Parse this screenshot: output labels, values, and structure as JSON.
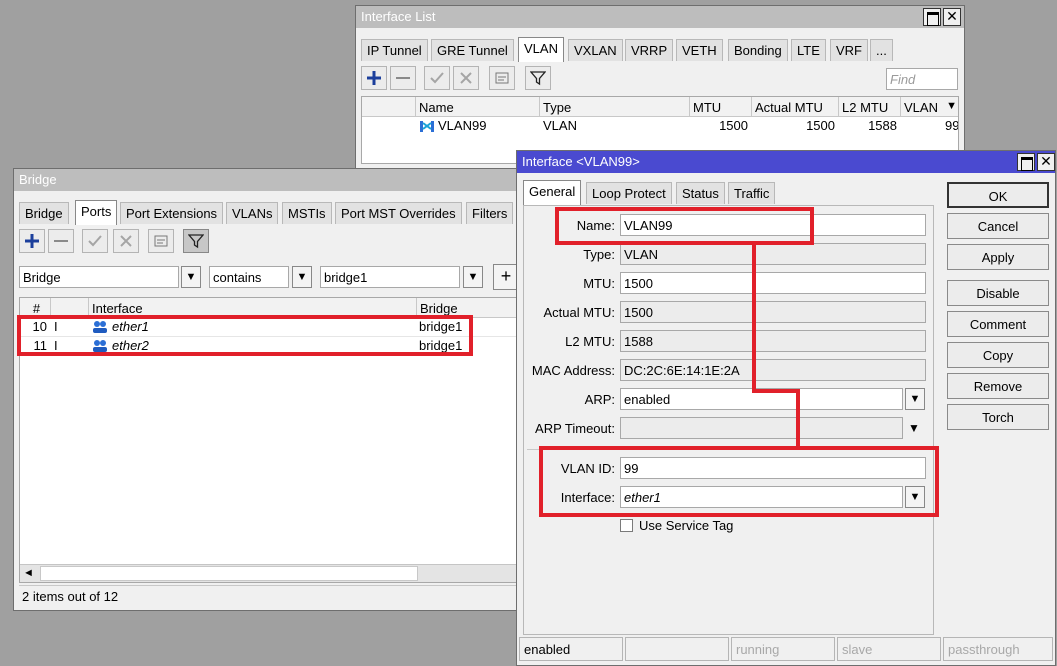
{
  "interface_list": {
    "title": "Interface List",
    "tabs": [
      "IP Tunnel",
      "GRE Tunnel",
      "VLAN",
      "VXLAN",
      "VRRP",
      "VETH",
      "Bonding",
      "LTE",
      "VRF",
      "..."
    ],
    "find_placeholder": "Find",
    "columns": [
      "Name",
      "Type",
      "MTU",
      "Actual MTU",
      "L2 MTU",
      "VLAN"
    ],
    "rows": [
      {
        "name": "VLAN99",
        "type": "VLAN",
        "mtu": "1500",
        "actual_mtu": "1500",
        "l2_mtu": "1588",
        "vlan": "99"
      }
    ]
  },
  "bridge": {
    "title": "Bridge",
    "tabs": [
      "Bridge",
      "Ports",
      "Port Extensions",
      "VLANs",
      "MSTIs",
      "Port MST Overrides",
      "Filters"
    ],
    "filter": {
      "field": "Bridge",
      "operator": "contains",
      "value": "bridge1",
      "add": "+"
    },
    "columns": [
      "#",
      "",
      "Interface",
      "Bridge"
    ],
    "rows": [
      {
        "num": "10",
        "flag": "I",
        "interface": "ether1",
        "bridge": "bridge1"
      },
      {
        "num": "11",
        "flag": "I",
        "interface": "ether2",
        "bridge": "bridge1"
      }
    ],
    "scroll_left": "◄",
    "status": "2 items out of 12"
  },
  "vlan_dialog": {
    "title": "Interface <VLAN99>",
    "tabs": [
      "General",
      "Loop Protect",
      "Status",
      "Traffic"
    ],
    "fields": {
      "name": {
        "label": "Name:",
        "value": "VLAN99"
      },
      "type": {
        "label": "Type:",
        "value": "VLAN"
      },
      "mtu": {
        "label": "MTU:",
        "value": "1500"
      },
      "actual_mtu": {
        "label": "Actual MTU:",
        "value": "1500"
      },
      "l2_mtu": {
        "label": "L2 MTU:",
        "value": "1588"
      },
      "mac": {
        "label": "MAC Address:",
        "value": "DC:2C:6E:14:1E:2A"
      },
      "arp": {
        "label": "ARP:",
        "value": "enabled"
      },
      "arp_timeout": {
        "label": "ARP Timeout:",
        "value": ""
      },
      "vlan_id": {
        "label": "VLAN ID:",
        "value": "99"
      },
      "interface": {
        "label": "Interface:",
        "value": "ether1"
      }
    },
    "use_service_tag": {
      "label": "Use Service Tag",
      "checked": false
    },
    "buttons": [
      "OK",
      "Cancel",
      "Apply",
      "Disable",
      "Comment",
      "Copy",
      "Remove",
      "Torch"
    ],
    "status_bar": [
      "enabled",
      "",
      "running",
      "slave",
      "passthrough"
    ]
  },
  "colors": {
    "highlight": "#e1202a",
    "active_title": "#4a4ad0",
    "inactive_title": "#bdbdbd"
  }
}
